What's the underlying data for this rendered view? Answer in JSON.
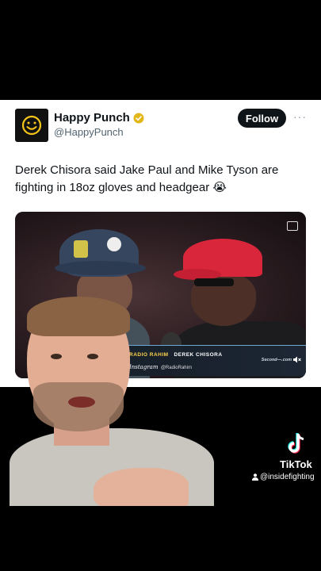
{
  "tweet": {
    "display_name": "Happy Punch",
    "handle": "@HappyPunch",
    "follow_label": "Follow",
    "more_label": "···",
    "text": "Derek Chisora said Jake Paul and Mike Tyson are fighting in 18oz gloves and headgear 😭",
    "avatar_icon": "smiley-face-icon",
    "verified_icon": "verified-badge-icon",
    "brand_color": "#f5c518"
  },
  "media": {
    "lower_third": {
      "show_name": "RADIO RAHIM",
      "guest_name": "DEREK CHISORA",
      "instagram_label": "Instagram",
      "instagram_handle": "@RadioRahim",
      "right_text": "Second—.com"
    }
  },
  "watermark": {
    "app_name": "TikTok",
    "handle": "@insidefighting"
  }
}
